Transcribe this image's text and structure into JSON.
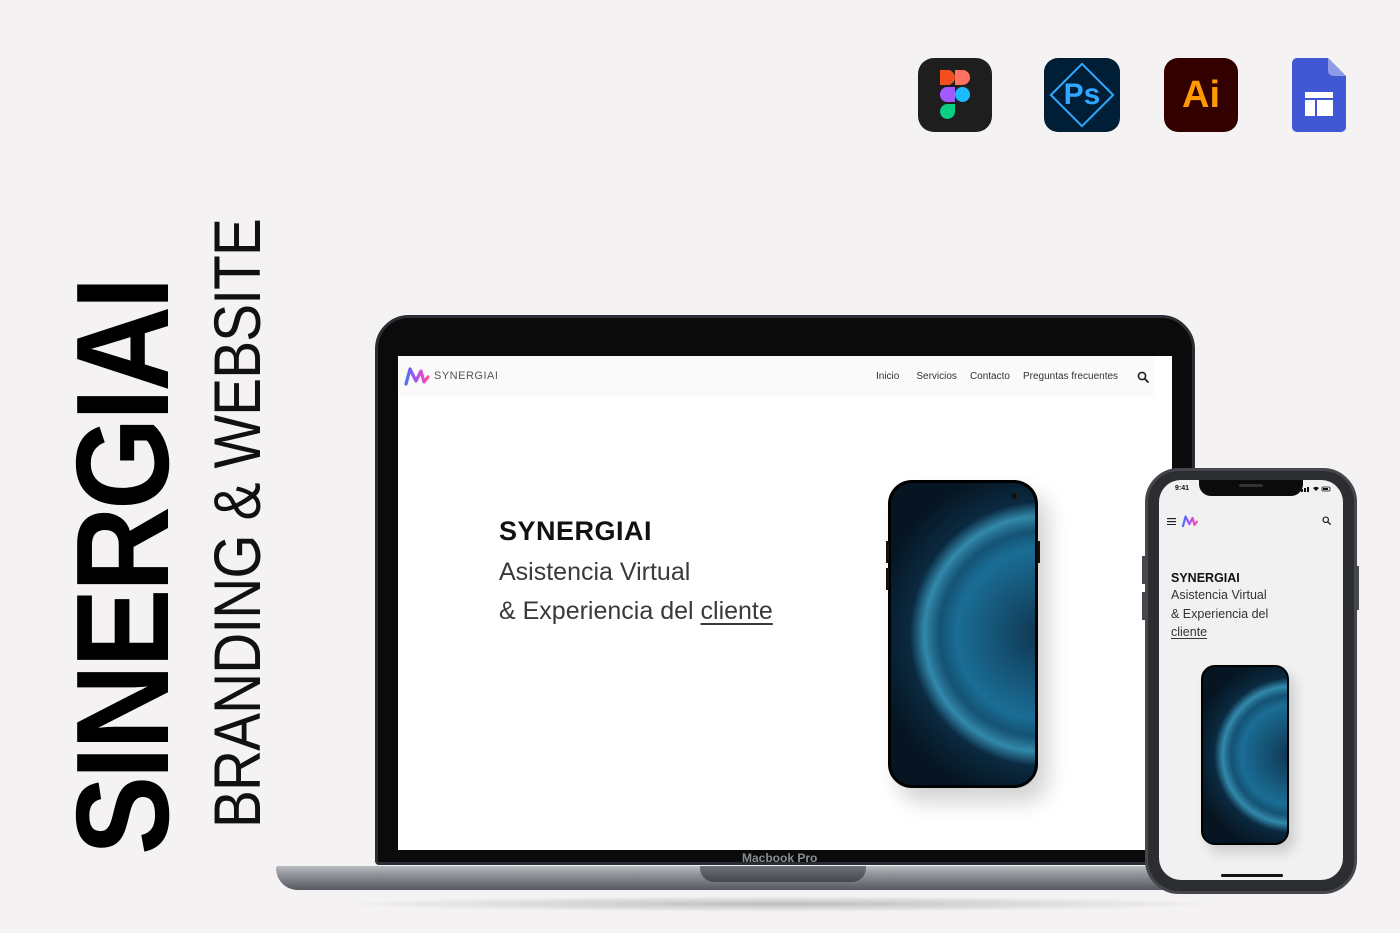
{
  "project": {
    "title": "SINERGIAI",
    "subtitle": "BRANDING & WEBSITE"
  },
  "tools": {
    "figma_icon": "figma-icon",
    "photoshop_label": "Ps",
    "illustrator_label": "Ai",
    "sites_icon": "google-sites-icon"
  },
  "website": {
    "brand": "SYNERGIAI",
    "nav": [
      "Inicio",
      "Servicios",
      "Contacto",
      "Preguntas frecuentes"
    ],
    "hero_title": "SYNERGIAI",
    "hero_line1": "Asistencia Virtual",
    "hero_line2_prefix": "& Experiencia del ",
    "hero_line2_link": "cliente"
  },
  "laptop": {
    "label": "Macbook Pro"
  },
  "mobile": {
    "time": "9:41",
    "hero_title": "SYNERGIAI",
    "line1": "Asistencia Virtual",
    "line2": "& Experiencia del",
    "line3": "cliente"
  },
  "colors": {
    "background": "#f4f2f2",
    "photoshop_bg": "#001e36",
    "photoshop_fg": "#31a8ff",
    "illustrator_bg": "#330000",
    "illustrator_fg": "#ff9a00",
    "sites_blue": "#4285f4"
  }
}
